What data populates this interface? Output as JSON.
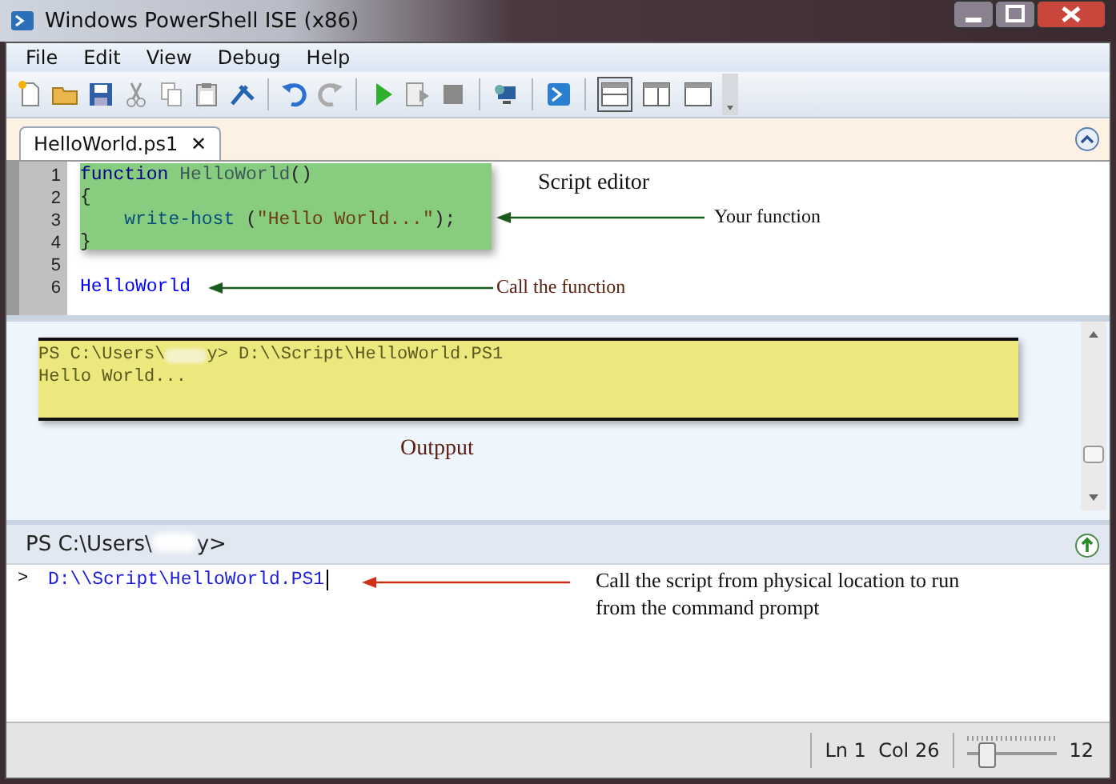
{
  "window": {
    "title": "Windows PowerShell ISE (x86)"
  },
  "menu": [
    "File",
    "Edit",
    "View",
    "Debug",
    "Help"
  ],
  "toolbar": {
    "layout_buttons": [
      {
        "selected": true
      },
      {
        "selected": false
      },
      {
        "selected": false
      }
    ]
  },
  "tabs": [
    {
      "label": "HelloWorld.ps1",
      "close": "✕",
      "selected": true
    }
  ],
  "editor": {
    "lines": [
      {
        "number": "1",
        "tokens": [
          {
            "kind": "keyword",
            "text": "function "
          },
          {
            "kind": "name",
            "text": "HelloWorld"
          },
          {
            "kind": "plain",
            "text": "()"
          }
        ]
      },
      {
        "number": "2",
        "tokens": [
          {
            "kind": "plain",
            "text": "{"
          }
        ]
      },
      {
        "number": "3",
        "indent": true,
        "tokens": [
          {
            "kind": "command",
            "text": "write-host"
          },
          {
            "kind": "plain",
            "text": " ("
          },
          {
            "kind": "string",
            "text": "\"Hello World...\""
          },
          {
            "kind": "plain",
            "text": ");"
          }
        ]
      },
      {
        "number": "4",
        "tokens": [
          {
            "kind": "plain",
            "text": "}"
          }
        ]
      },
      {
        "number": "5"
      },
      {
        "number": "6",
        "tokens": [
          {
            "kind": "call",
            "text": "HelloWorld"
          }
        ]
      }
    ],
    "annotations": {
      "title": "Script editor",
      "function_note": "Your function",
      "call_note": "Call the function"
    }
  },
  "output": {
    "prompt_prefix": "PS C:\\Users\\",
    "prompt_suffix": "y> D:\\\\Script\\HelloWorld.PS1",
    "result": "Hello World...",
    "caption": "Outpput"
  },
  "console": {
    "prompt_prefix": "PS C:\\Users\\",
    "prompt_suffix": "y>",
    "marker": ">",
    "input": "D:\\\\Script\\HelloWorld.PS1",
    "note": "Call the script from physical location to run from the command prompt"
  },
  "status_bar": {
    "position": "Ln 1  Col 26",
    "zoom": {
      "level": 0.2,
      "reading": "12"
    }
  }
}
